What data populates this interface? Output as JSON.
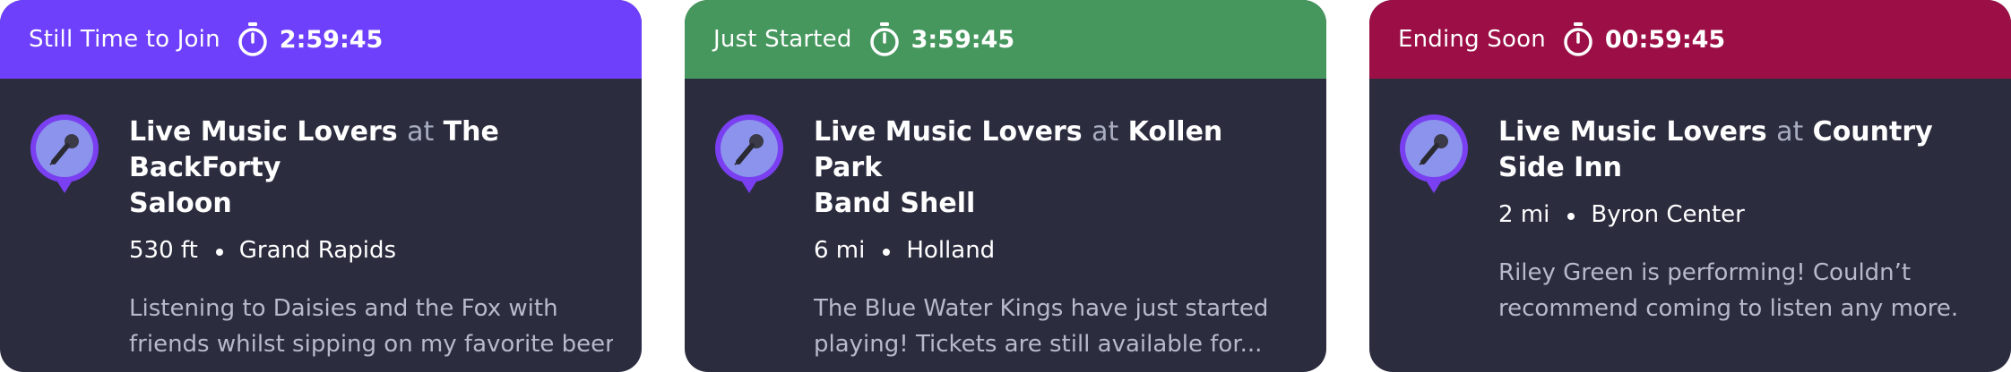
{
  "cards": [
    {
      "status": "Still Time to Join",
      "timer": "2:59:45",
      "header_color": "#6e40fb",
      "group": "Live Music Lovers",
      "at": "at",
      "venue": "The BackForty Saloon",
      "venue_line1": "The BackForty",
      "venue_line2": "Saloon",
      "distance": "530 ft",
      "city": "Grand Rapids",
      "desc_line1": "Listening to Daisies and the Fox with",
      "desc_line2": "friends whilst sipping on my favorite beer..",
      "icon": "microphone-icon"
    },
    {
      "status": "Just Started",
      "timer": "3:59:45",
      "header_color": "#46975e",
      "group": "Live Music Lovers",
      "at": "at",
      "venue": "Kollen Park Band Shell",
      "venue_line1": "Kollen Park",
      "venue_line2": "Band Shell",
      "distance": "6 mi",
      "city": "Holland",
      "desc_line1": "The Blue Water Kings have just started",
      "desc_line2": "playing! Tickets are still available for...",
      "icon": "microphone-icon"
    },
    {
      "status": "Ending Soon",
      "timer": "00:59:45",
      "header_color": "#9b0f46",
      "group": "Live Music Lovers",
      "at": "at",
      "venue": "Country Side Inn",
      "venue_line1": "Country",
      "venue_line2": "Side Inn",
      "distance": "2 mi",
      "city": "Byron Center",
      "desc_line1": "Riley Green is performing! Couldn’t",
      "desc_line2": "recommend coming to listen any more.",
      "icon": "microphone-icon"
    }
  ],
  "colors": {
    "card_body": "#2b2d3f",
    "pin_fill": "#8b93ec",
    "pin_ring": "#7a3ff0"
  }
}
